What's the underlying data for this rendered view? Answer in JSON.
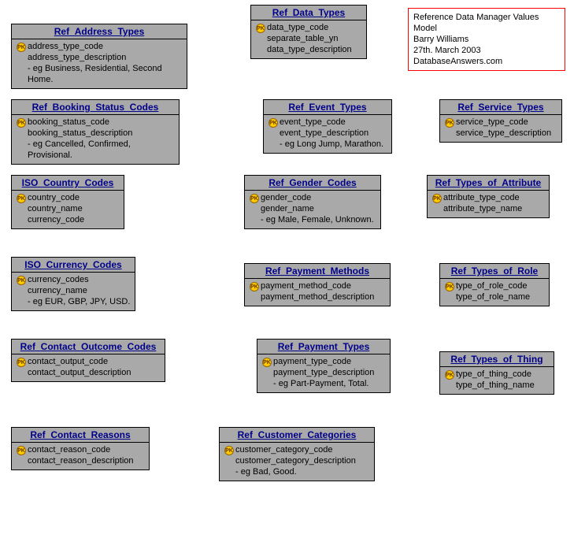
{
  "info": {
    "line1": "Reference Data Manager Values Model",
    "line2": "Barry Williams",
    "line3": "27th. March 2003",
    "line4": "DatabaseAnswers.com"
  },
  "entities": {
    "ref_address_types": {
      "title": "Ref_Address_Types",
      "pk": "address_type_code",
      "f1": "address_type_description",
      "note": "- eg Business, Residential, Second Home."
    },
    "ref_data_types": {
      "title": "Ref_Data_Types",
      "pk": "data_type_code",
      "f1": "separate_table_yn",
      "f2": "data_type_description"
    },
    "ref_booking_status_codes": {
      "title": "Ref_Booking_Status_Codes",
      "pk": "booking_status_code",
      "f1": "booking_status_description",
      "note": "- eg Cancelled, Confirmed, Provisional."
    },
    "ref_event_types": {
      "title": "Ref_Event_Types",
      "pk": "event_type_code",
      "f1": "event_type_description",
      "note": "- eg Long Jump, Marathon."
    },
    "ref_service_types": {
      "title": "Ref_Service_Types",
      "pk": "service_type_code",
      "f1": "service_type_description"
    },
    "iso_country_codes": {
      "title": "ISO_Country_Codes",
      "pk": "country_code",
      "f1": "country_name",
      "f2": "currency_code"
    },
    "ref_gender_codes": {
      "title": "Ref_Gender_Codes",
      "pk": "gender_code",
      "f1": "gender_name",
      "note": "- eg Male, Female, Unknown."
    },
    "ref_types_of_attribute": {
      "title": "Ref_Types_of_Attribute",
      "pk": "attribute_type_code",
      "f1": "attribute_type_name"
    },
    "iso_currency_codes": {
      "title": "ISO_Currency_Codes",
      "pk": "currency_codes",
      "f1": "currency_name",
      "note": "- eg EUR, GBP, JPY, USD."
    },
    "ref_payment_methods": {
      "title": "Ref_Payment_Methods",
      "pk": "payment_method_code",
      "f1": "payment_method_description"
    },
    "ref_types_of_role": {
      "title": "Ref_Types_of_Role",
      "pk": "type_of_role_code",
      "f1": "type_of_role_name"
    },
    "ref_contact_outcome_codes": {
      "title": "Ref_Contact_Outcome_Codes",
      "pk": "contact_output_code",
      "f1": "contact_output_description"
    },
    "ref_payment_types": {
      "title": "Ref_Payment_Types",
      "pk": "payment_type_code",
      "f1": "payment_type_description",
      "note": "- eg Part-Payment, Total."
    },
    "ref_types_of_thing": {
      "title": "Ref_Types_of_Thing",
      "pk": "type_of_thing_code",
      "f1": "type_of_thing_name"
    },
    "ref_contact_reasons": {
      "title": "Ref_Contact_Reasons",
      "pk": "contact_reason_code",
      "f1": "contact_reason_description"
    },
    "ref_customer_categories": {
      "title": "Ref_Customer_Categories",
      "pk": "customer_category_code",
      "f1": "customer_category_description",
      "note": "- eg Bad, Good."
    }
  }
}
